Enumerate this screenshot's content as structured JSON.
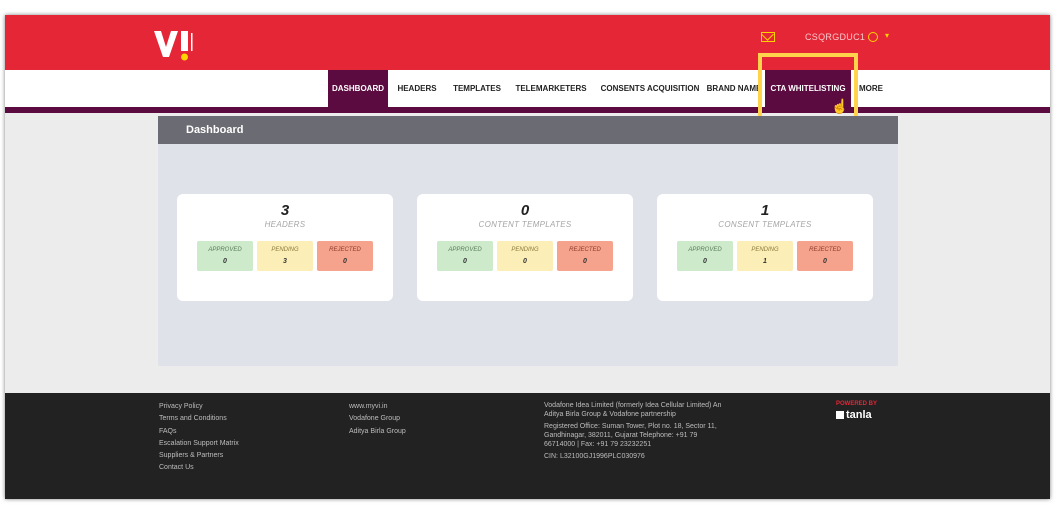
{
  "header": {
    "logo_text": "VI",
    "user_name": "CSQRGDUC1"
  },
  "nav": {
    "items": [
      {
        "label": "DASHBOARD",
        "active": true
      },
      {
        "label": "HEADERS"
      },
      {
        "label": "TEMPLATES"
      },
      {
        "label": "TELEMARKETERS"
      },
      {
        "label": "CONSENTS ACQUISITION"
      },
      {
        "label": "BRAND NAME"
      },
      {
        "label": "CTA WHITELISTING",
        "highlighted": true
      },
      {
        "label": "MORE"
      }
    ]
  },
  "panel": {
    "title": "Dashboard"
  },
  "cards": [
    {
      "count": "3",
      "label": "HEADERS",
      "approved_label": "APPROVED",
      "approved": "0",
      "pending_label": "PENDING",
      "pending": "3",
      "rejected_label": "REJECTED",
      "rejected": "0"
    },
    {
      "count": "0",
      "label": "CONTENT TEMPLATES",
      "approved_label": "APPROVED",
      "approved": "0",
      "pending_label": "PENDING",
      "pending": "0",
      "rejected_label": "REJECTED",
      "rejected": "0"
    },
    {
      "count": "1",
      "label": "CONSENT TEMPLATES",
      "approved_label": "APPROVED",
      "approved": "0",
      "pending_label": "PENDING",
      "pending": "1",
      "rejected_label": "REJECTED",
      "rejected": "0"
    }
  ],
  "footer": {
    "col1": [
      "Privacy Policy",
      "Terms and Conditions",
      "FAQs",
      "Escalation Support Matrix",
      "Suppliers & Partners",
      "Contact Us"
    ],
    "col2": [
      "www.myvi.in",
      "Vodafone Group",
      "Aditya Birla Group"
    ],
    "col3": {
      "company": "Vodafone Idea Limited (formerly Idea Cellular Limited) An Aditya Birla Group & Vodafone partnership",
      "office": "Registered Office: Suman Tower, Plot no. 18, Sector 11, Gandhinagar, 382011, Gujarat Telephone: +91 79 66714000 | Fax: +91 79 23232251",
      "cin": "CIN: L32100GJ1996PLC030976"
    },
    "powered_by": "POWERED BY",
    "brand": "tanla"
  },
  "colors": {
    "brand_red": "#e52636",
    "nav_active": "#5b0b3f",
    "highlight": "#ffd44c"
  }
}
